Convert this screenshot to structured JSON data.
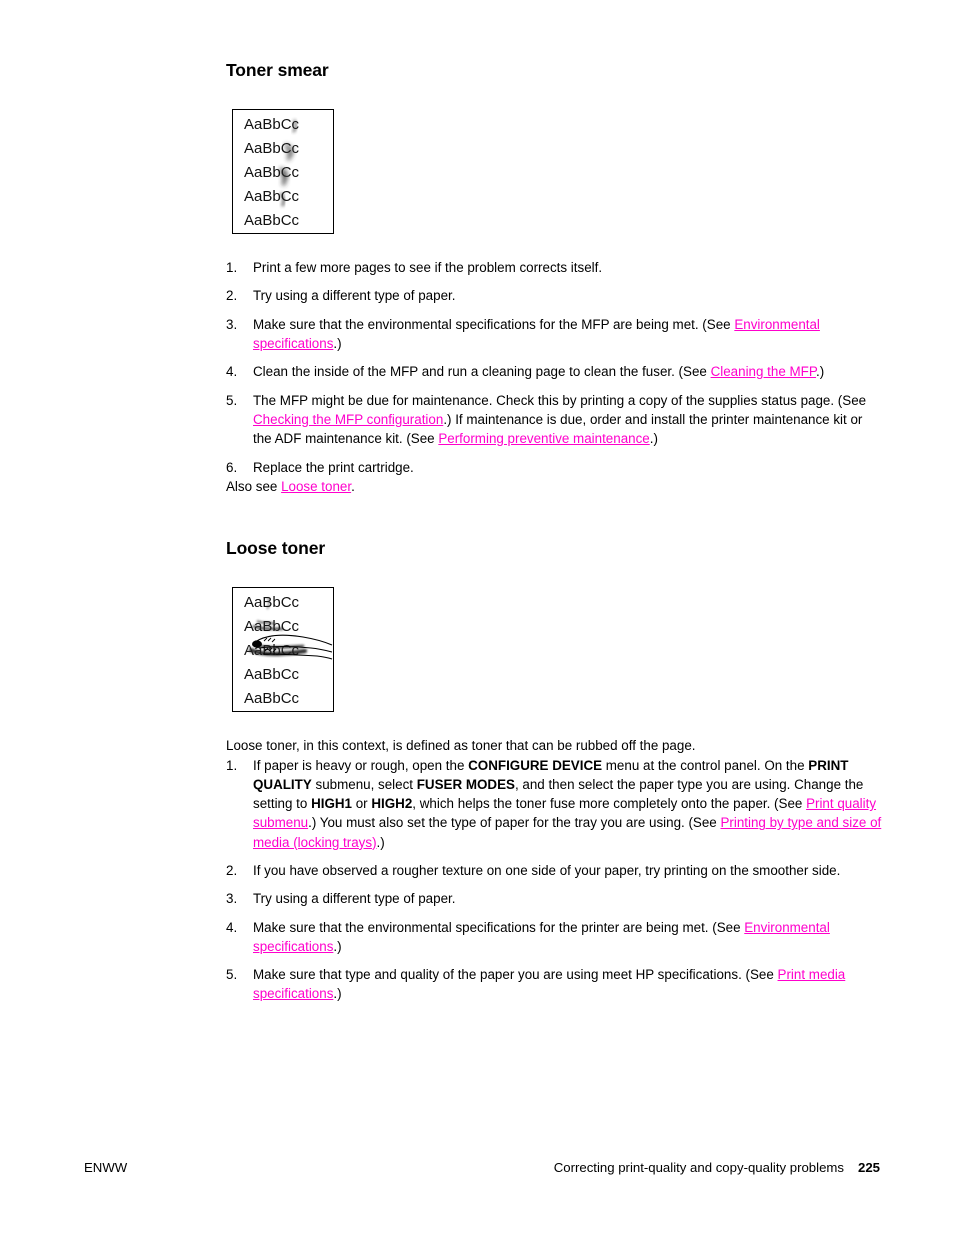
{
  "document": {
    "page_number": "225",
    "footer_left": "ENWW",
    "footer_right": "Correcting print-quality and copy-quality problems"
  },
  "sections": [
    {
      "id": "toner-smear",
      "heading": "Toner smear",
      "sample": {
        "alt": "Print sample showing toner smear defect",
        "lines": [
          "AaBbCc",
          "AaBbCc",
          "AaBbCc",
          "AaBbCc",
          "AaBbCc"
        ],
        "defect": "toner-smear"
      },
      "steps": [
        {
          "num": "1.",
          "text": "Print a few more pages to see if the problem corrects itself."
        },
        {
          "num": "2.",
          "text": "Try using a different type of paper."
        },
        {
          "num": "3.",
          "text": "Make sure that the environmental specifications for the MFP are being met. (See Environmental specifications.)"
        },
        {
          "num": "4.",
          "text": "Clean the inside of the MFP and run a cleaning page to clean the fuser. (See Cleaning the MFP.)"
        },
        {
          "num": "5.",
          "text": "The MFP might be due for maintenance. Check this by printing a copy of the supplies status page. (See Checking the MFP configuration.) If maintenance is due, order and install the printer maintenance kit or the ADF maintenance kit. (See Performing preventive maintenance.)"
        },
        {
          "num": "6.",
          "text": "Replace the print cartridge."
        }
      ],
      "also_see": {
        "prefix": "Also see ",
        "link": "Loose toner",
        "suffix": "."
      }
    },
    {
      "id": "loose-toner",
      "heading": "Loose toner",
      "sample": {
        "alt": "Print sample showing loose toner being rubbed off by a finger",
        "lines": [
          "AaBbCc",
          "AaBbCc",
          "AaBbCc",
          "AaBbCc",
          "AaBbCc"
        ],
        "defect": "loose-toner"
      },
      "intro": "Loose toner, in this context, is defined as toner that can be rubbed off the page.",
      "steps": [
        {
          "num": "1.",
          "text": "If paper is heavy or rough, open the CONFIGURE DEVICE menu at the control panel. On the PRINT QUALITY submenu, select FUSER MODES, and then select the paper type you are using. Change the setting to HIGH1 or HIGH2, which helps the toner fuse more completely onto the paper. (See Print quality submenu.) You must also set the type of paper for the tray you are using. (See Printing by type and size of media (locking trays).)"
        },
        {
          "num": "2.",
          "text": "If you have observed a rougher texture on one side of your paper, try printing on the smoother side."
        },
        {
          "num": "3.",
          "text": "Try using a different type of paper."
        },
        {
          "num": "4.",
          "text": "Make sure that the environmental specifications for the printer are being met. (See Environmental specifications.)"
        },
        {
          "num": "5.",
          "text": "Make sure that type and quality of the paper you are using meet HP specifications. (See Print media specifications.)"
        }
      ]
    }
  ],
  "fragments": {
    "s1_step1": "Print a few more pages to see if the problem corrects itself.",
    "s1_step2": "Try using a different type of paper.",
    "s1_step3_a": "Make sure that the environmental specifications for the MFP are being met. (See ",
    "s1_step3_link": "Environmental specifications",
    "s1_step3_b": ".)",
    "s1_step4_a": "Clean the inside of the MFP and run a cleaning page to clean the fuser. (See ",
    "s1_step4_link": "Cleaning the MFP",
    "s1_step4_b": ".)",
    "s1_step5_a": "The MFP might be due for maintenance. Check this by printing a copy of the supplies status page. (See ",
    "s1_step5_link1": "Checking the MFP configuration",
    "s1_step5_b": ".) If maintenance is due, order and install the printer maintenance kit or the ADF maintenance kit. (See ",
    "s1_step5_link2": "Performing preventive maintenance",
    "s1_step5_c": ".)",
    "s1_step6": "Replace the print cartridge.",
    "s2_intro": "Loose toner, in this context, is defined as toner that can be rubbed off the page.",
    "s2_step1_a": "If paper is heavy or rough, open the ",
    "s2_step1_b1": "CONFIGURE DEVICE",
    "s2_step1_c": " menu at the control panel. On the ",
    "s2_step1_b2": "PRINT QUALITY",
    "s2_step1_d": " submenu, select ",
    "s2_step1_b3": "FUSER MODES",
    "s2_step1_e": ", and then select the paper type you are using. Change the setting to ",
    "s2_step1_b4": "HIGH1",
    "s2_step1_f": " or ",
    "s2_step1_b5": "HIGH2",
    "s2_step1_g": ", which helps the toner fuse more completely onto the paper. (See ",
    "s2_step1_link1": "Print quality submenu",
    "s2_step1_h": ".) You must also set the type of paper for the tray you are using. (See ",
    "s2_step1_link2": "Printing by type and size of media (locking trays)",
    "s2_step1_i": ".)",
    "s2_step2": "If you have observed a rougher texture on one side of your paper, try printing on the smoother side.",
    "s2_step3": "Try using a different type of paper.",
    "s2_step4_a": "Make sure that the environmental specifications for the printer are being met. (See ",
    "s2_step4_link": "Environmental specifications",
    "s2_step4_b": ".)",
    "s2_step5_a": "Make sure that type and quality of the paper you are using meet HP specifications. (See ",
    "s2_step5_link": "Print media specifications",
    "s2_step5_b": ".)"
  },
  "sample_text": {
    "line": "AaBbCc"
  },
  "colors": {
    "link": "#ff00cc",
    "text": "#000000",
    "background": "#ffffff"
  }
}
